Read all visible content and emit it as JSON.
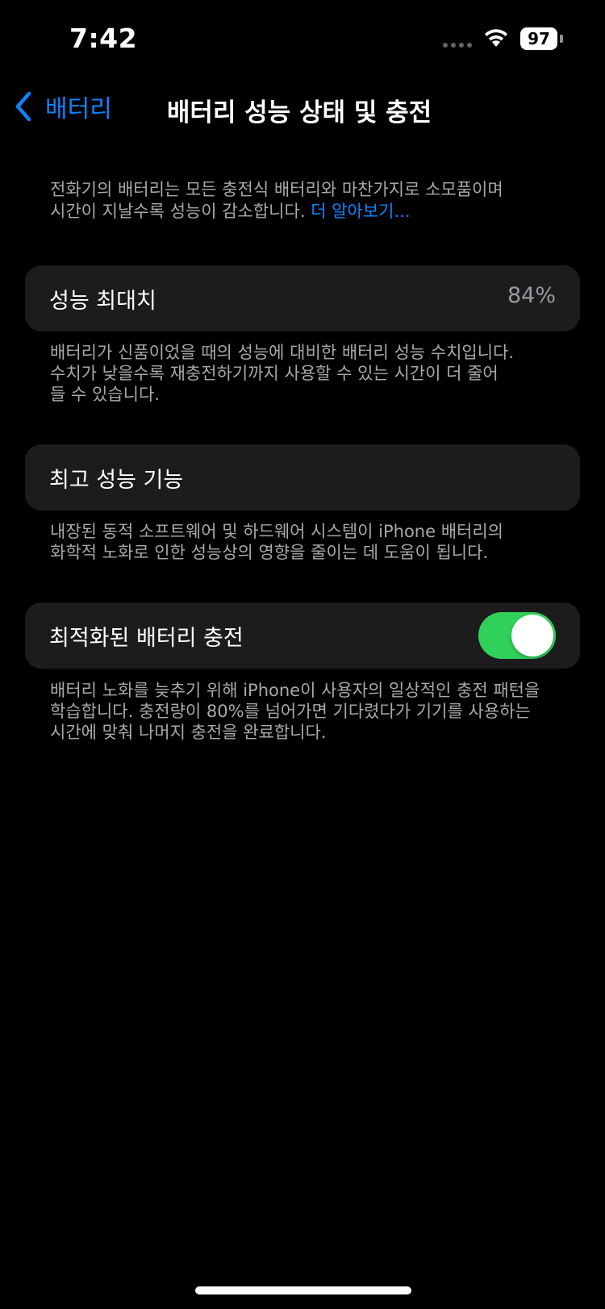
{
  "status_bar": {
    "time": "7:42",
    "battery_level": "97",
    "icons": [
      "signal-dots-icon",
      "wifi-icon",
      "battery-icon"
    ]
  },
  "nav": {
    "back_label": "배터리",
    "title": "배터리 성능 상태 및 충전"
  },
  "intro": {
    "line1": "전화기의 배터리는 모든 충전식 배터리와 마찬가지로 소모품이며",
    "line2": "시간이 지날수록 성능이 감소합니다.",
    "learn_more": "더 알아보기..."
  },
  "maximum_capacity": {
    "label": "성능 최대치",
    "value": "84%",
    "footer": [
      "배터리가 신품이었을 때의 성능에 대비한 배터리 성능 수치입니다.",
      "수치가 낮을수록 재충전하기까지 사용할 수 있는 시간이 더 줄어",
      "들 수 있습니다."
    ]
  },
  "peak_performance": {
    "label": "최고 성능 기능",
    "footer": [
      "내장된 동적 소프트웨어 및 하드웨어 시스템이 iPhone 배터리의",
      "화학적 노화로 인한 성능상의 영향을 줄이는 데 도움이 됩니다."
    ]
  },
  "optimized_charging": {
    "label": "최적화된 배터리 충전",
    "enabled": true,
    "footer": [
      "배터리 노화를 늦추기 위해 iPhone이 사용자의 일상적인 충전 패턴을",
      "학습합니다. 충전량이 80%를 넘어가면 기다렸다가 기기를 사용하는",
      "시간에 맞춰 나머지 충전을 완료합니다."
    ]
  },
  "colors": {
    "accent": "#0a84ff",
    "toggle_on": "#30d158",
    "cell_background": "#1c1c1e",
    "background": "#000000"
  }
}
